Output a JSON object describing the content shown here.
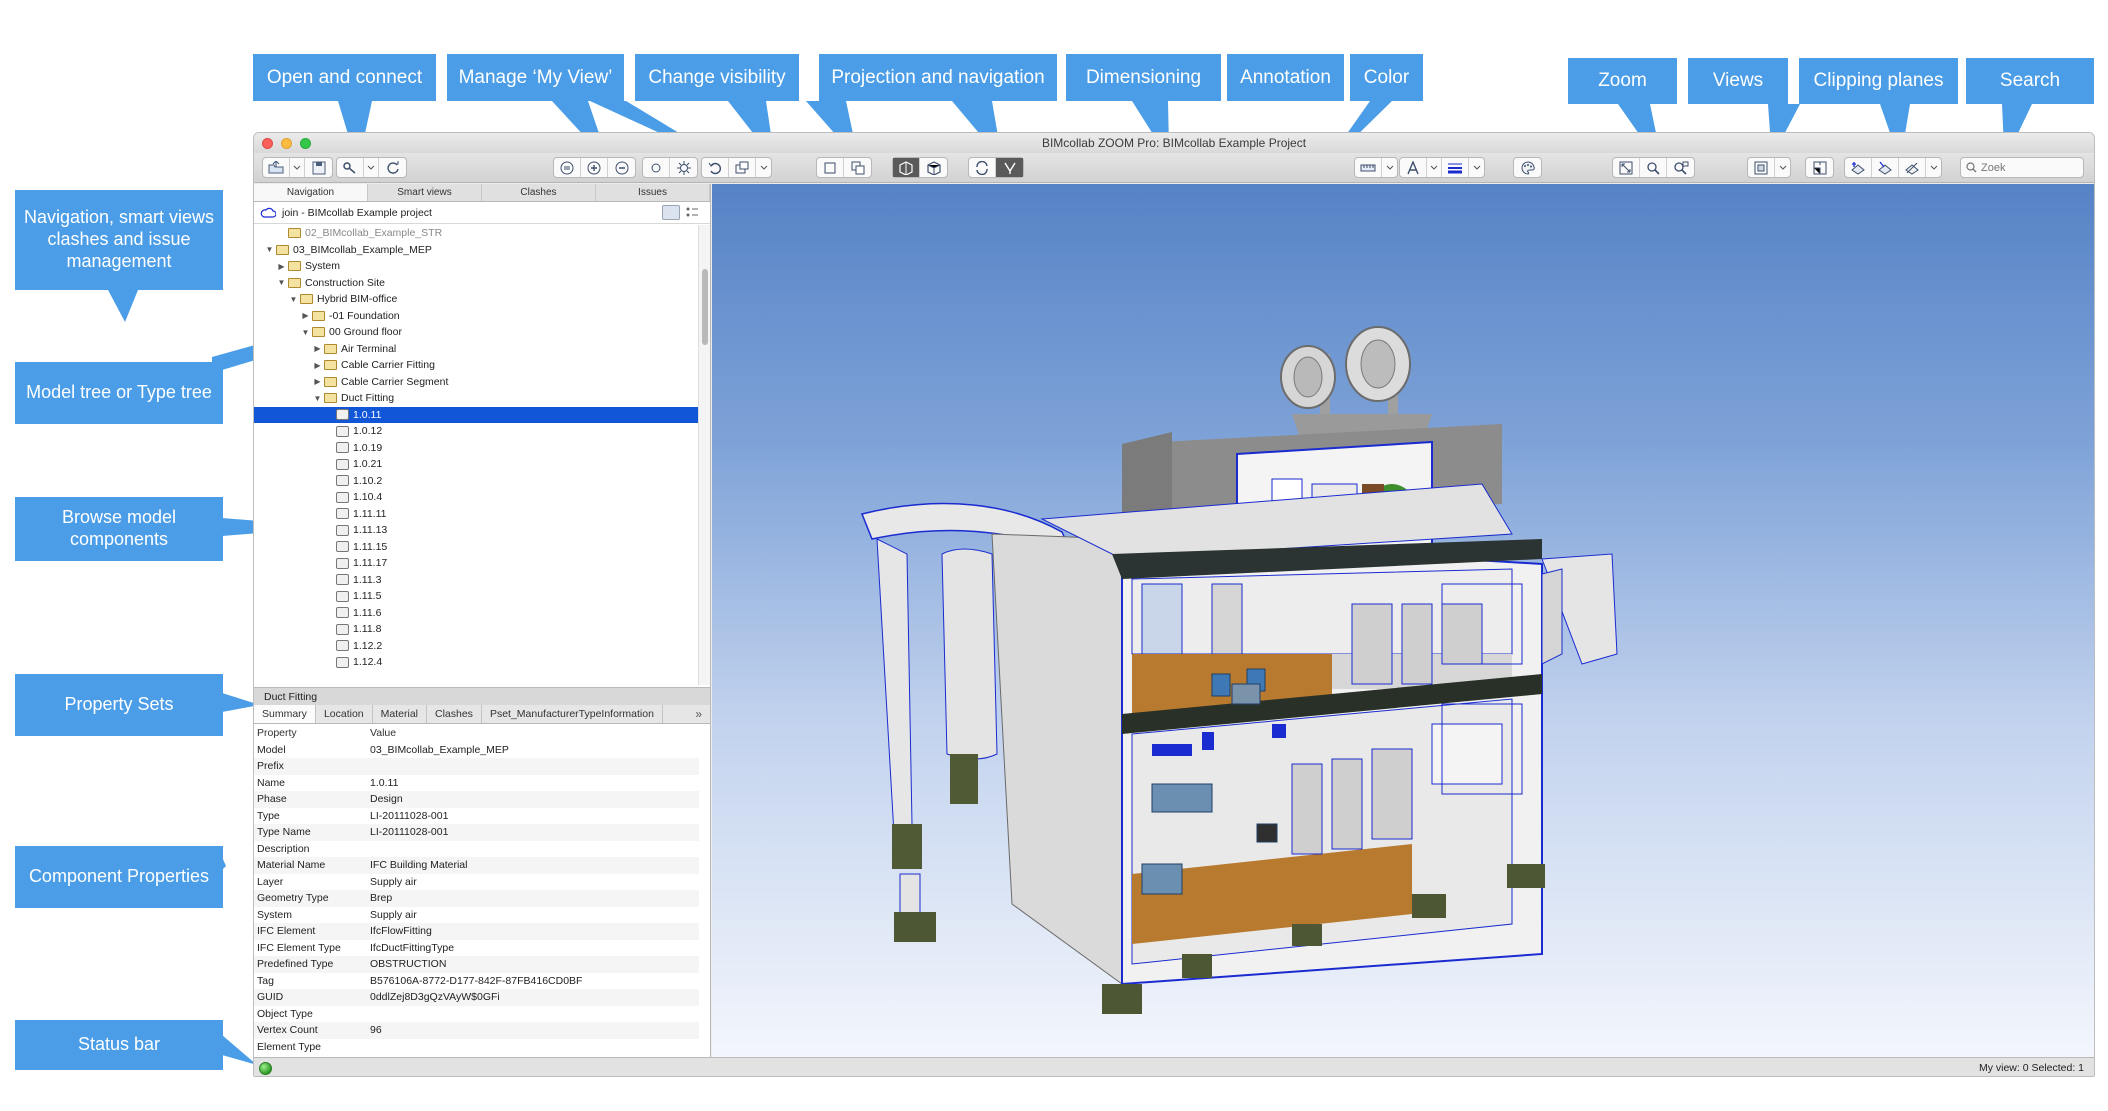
{
  "callouts": {
    "open_connect": "Open and connect",
    "manage_view": "Manage ‘My View’",
    "change_visibility": "Change visibility",
    "projection_navigation": "Projection and navigation",
    "dimensioning": "Dimensioning",
    "annotation": "Annotation",
    "color": "Color",
    "zoom": "Zoom",
    "views": "Views",
    "clipping_planes": "Clipping planes",
    "search": "Search",
    "navigation_smart": "Navigation, smart views clashes and issue management",
    "model_tree": "Model tree or Type tree",
    "browse": "Browse model components",
    "property_sets": "Property Sets",
    "component_properties": "Component Properties",
    "status_bar": "Status bar"
  },
  "window": {
    "title": "BIMcollab ZOOM Pro: BIMcollab Example Project"
  },
  "search": {
    "placeholder": "Zoek"
  },
  "tabs": [
    "Navigation",
    "Smart views",
    "Clashes",
    "Issues"
  ],
  "project": {
    "label": "join - BIMcollab Example project"
  },
  "tree": [
    {
      "label": "02_BIMcollab_Example_STR",
      "indent": 1,
      "arrow": "",
      "icon": "folder",
      "grey": true
    },
    {
      "label": "03_BIMcollab_Example_MEP",
      "indent": 0,
      "arrow": "▼",
      "icon": "folder"
    },
    {
      "label": "System",
      "indent": 1,
      "arrow": "▶",
      "icon": "folder"
    },
    {
      "label": "Construction Site",
      "indent": 1,
      "arrow": "▼",
      "icon": "folder"
    },
    {
      "label": "Hybrid BIM-office",
      "indent": 2,
      "arrow": "▼",
      "icon": "folder"
    },
    {
      "label": "-01 Foundation",
      "indent": 3,
      "arrow": "▶",
      "icon": "folder"
    },
    {
      "label": "00 Ground floor",
      "indent": 3,
      "arrow": "▼",
      "icon": "folder"
    },
    {
      "label": "Air Terminal",
      "indent": 4,
      "arrow": "▶",
      "icon": "folder"
    },
    {
      "label": "Cable Carrier Fitting",
      "indent": 4,
      "arrow": "▶",
      "icon": "folder"
    },
    {
      "label": "Cable Carrier Segment",
      "indent": 4,
      "arrow": "▶",
      "icon": "folder"
    },
    {
      "label": "Duct Fitting",
      "indent": 4,
      "arrow": "▼",
      "icon": "folder"
    },
    {
      "label": "1.0.11",
      "indent": 5,
      "arrow": "",
      "icon": "elem",
      "selected": true
    },
    {
      "label": "1.0.12",
      "indent": 5,
      "arrow": "",
      "icon": "elem"
    },
    {
      "label": "1.0.19",
      "indent": 5,
      "arrow": "",
      "icon": "elem"
    },
    {
      "label": "1.0.21",
      "indent": 5,
      "arrow": "",
      "icon": "elem"
    },
    {
      "label": "1.10.2",
      "indent": 5,
      "arrow": "",
      "icon": "elem"
    },
    {
      "label": "1.10.4",
      "indent": 5,
      "arrow": "",
      "icon": "elem"
    },
    {
      "label": "1.11.11",
      "indent": 5,
      "arrow": "",
      "icon": "elem"
    },
    {
      "label": "1.11.13",
      "indent": 5,
      "arrow": "",
      "icon": "elem"
    },
    {
      "label": "1.11.15",
      "indent": 5,
      "arrow": "",
      "icon": "elem"
    },
    {
      "label": "1.11.17",
      "indent": 5,
      "arrow": "",
      "icon": "elem"
    },
    {
      "label": "1.11.3",
      "indent": 5,
      "arrow": "",
      "icon": "elem"
    },
    {
      "label": "1.11.5",
      "indent": 5,
      "arrow": "",
      "icon": "elem"
    },
    {
      "label": "1.11.6",
      "indent": 5,
      "arrow": "",
      "icon": "elem"
    },
    {
      "label": "1.11.8",
      "indent": 5,
      "arrow": "",
      "icon": "elem"
    },
    {
      "label": "1.12.2",
      "indent": 5,
      "arrow": "",
      "icon": "elem"
    },
    {
      "label": "1.12.4",
      "indent": 5,
      "arrow": "",
      "icon": "elem"
    }
  ],
  "properties": {
    "header": "Duct Fitting",
    "tabs": [
      "Summary",
      "Location",
      "Material",
      "Clashes",
      "Pset_ManufacturerTypeInformation"
    ],
    "more": "»",
    "columns": [
      "Property",
      "Value"
    ],
    "rows": [
      [
        "Model",
        "03_BIMcollab_Example_MEP"
      ],
      [
        "Prefix",
        ""
      ],
      [
        "Name",
        "1.0.11"
      ],
      [
        "Phase",
        "Design"
      ],
      [
        "Type",
        "LI-20111028-001"
      ],
      [
        "Type Name",
        "LI-20111028-001"
      ],
      [
        "Description",
        ""
      ],
      [
        "Material Name",
        "IFC Building Material"
      ],
      [
        "Layer",
        "Supply air"
      ],
      [
        "Geometry Type",
        "Brep"
      ],
      [
        "System",
        "Supply air"
      ],
      [
        "IFC Element",
        "IfcFlowFitting"
      ],
      [
        "IFC Element Type",
        "IfcDuctFittingType"
      ],
      [
        "Predefined Type",
        "OBSTRUCTION"
      ],
      [
        "Tag",
        "B576106A-8772-D177-842F-87FB416CD0BF"
      ],
      [
        "GUID",
        "0ddlZej8D3gQzVAyW$0GFi"
      ],
      [
        "Object Type",
        ""
      ],
      [
        "Vertex Count",
        "96"
      ],
      [
        "Element Type",
        ""
      ]
    ]
  },
  "status": {
    "right": "My view: 0   Selected: 1"
  },
  "colors": {
    "callout": "#4a9de6",
    "selection": "#1056d6",
    "accent_blue": "#1a2bd0"
  }
}
